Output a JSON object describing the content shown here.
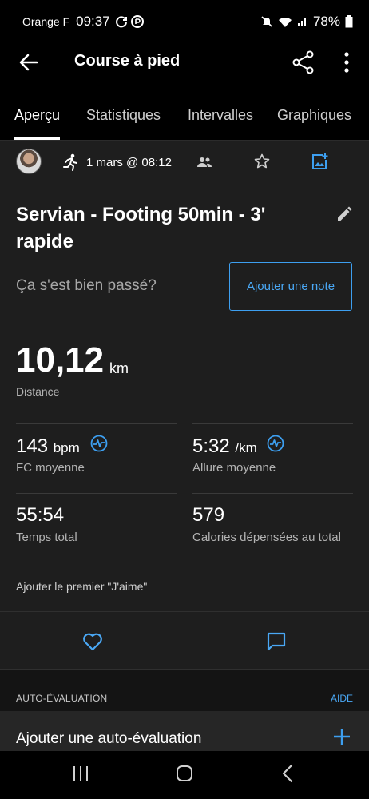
{
  "status_bar": {
    "carrier": "Orange F",
    "time": "09:37",
    "battery": "78%"
  },
  "app_bar": {
    "title": "Course à pied"
  },
  "tabs": [
    {
      "label": "Aperçu",
      "active": true
    },
    {
      "label": "Statistiques",
      "active": false
    },
    {
      "label": "Intervalles",
      "active": false
    },
    {
      "label": "Graphiques",
      "active": false
    }
  ],
  "activity": {
    "date": "1 mars @ 08:12",
    "title": "Servian - Footing 50min - 3' rapide",
    "feel_prompt": "Ça s'est bien passé?",
    "add_note_label": "Ajouter une note"
  },
  "distance": {
    "value": "10,12",
    "unit": "km",
    "label": "Distance"
  },
  "stats": {
    "hr": {
      "value": "143",
      "unit": "bpm",
      "label": "FC moyenne"
    },
    "pace": {
      "value": "5:32",
      "unit": "/km",
      "label": "Allure moyenne"
    },
    "time": {
      "value": "55:54",
      "label": "Temps total"
    },
    "calories": {
      "value": "579",
      "label": "Calories dépensées au total"
    }
  },
  "social": {
    "likes_text": "Ajouter le premier \"J'aime\""
  },
  "self_evaluation": {
    "section_title": "AUTO-ÉVALUATION",
    "help_label": "AIDE",
    "add_label": "Ajouter une auto-évaluation"
  },
  "colors": {
    "accent": "#3d9ff0",
    "background": "#1e1e1e",
    "bar": "#000000"
  }
}
